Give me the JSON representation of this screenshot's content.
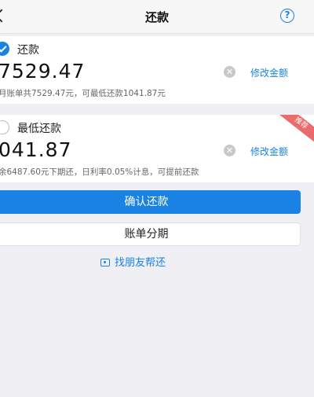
{
  "header": {
    "title": "还款",
    "help_glyph": "?"
  },
  "option_full": {
    "label": "还款",
    "amount": "7529.47",
    "modify": "修改金额",
    "description": "月账单共7529.47元，可最低还款1041.87元"
  },
  "option_min": {
    "label": "最低还款",
    "amount": "041.87",
    "modify": "修改金额",
    "description": "余6487.60元下期还，日利率0.05%计息，可提前还款",
    "ribbon": "推荐"
  },
  "actions": {
    "confirm": "确认还款",
    "installment": "账单分期",
    "friend": "找朋友帮还"
  },
  "colors": {
    "accent": "#1a82e2",
    "ribbon": "#e96b6b"
  }
}
